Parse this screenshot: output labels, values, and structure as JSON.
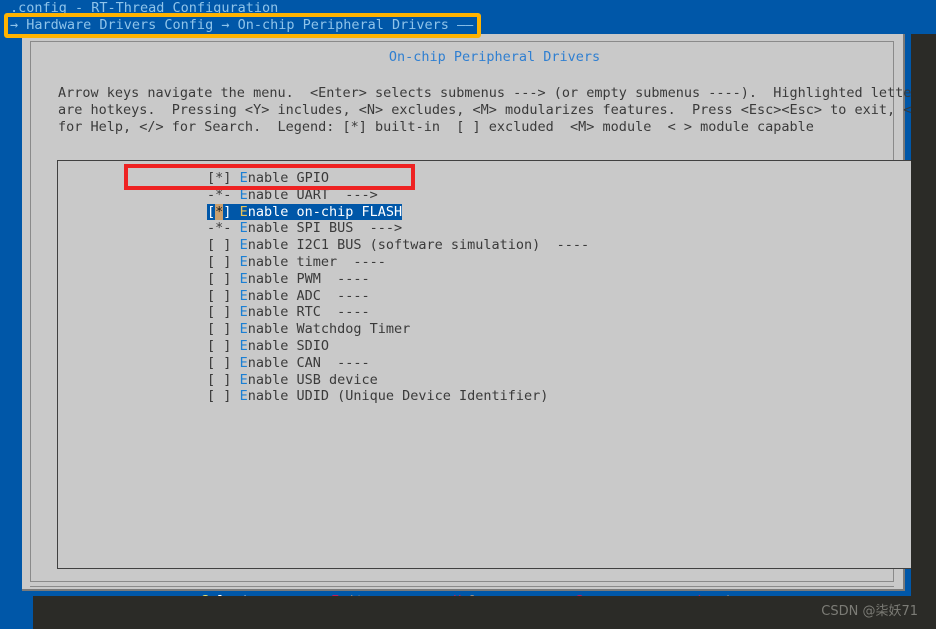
{
  "terminal": {
    "title": ".config - RT-Thread Configuration",
    "breadcrumb": "→ Hardware Drivers Config → On-chip Peripheral Drivers ——"
  },
  "dialog": {
    "frame_title": "On-chip Peripheral Drivers",
    "help_text": "Arrow keys navigate the menu.  <Enter> selects submenus ---> (or empty submenus ----).  Highlighted letters\nare hotkeys.  Pressing <Y> includes, <N> excludes, <M> modularizes features.  Press <Esc><Esc> to exit, <?>\nfor Help, </> for Search.  Legend: [*] built-in  [ ] excluded  <M> module  < > module capable"
  },
  "menu": {
    "items": [
      {
        "mark": "[*]",
        "hotkey": "E",
        "label": "nable GPIO",
        "suffix": "",
        "selected": false
      },
      {
        "mark": "-*-",
        "hotkey": "E",
        "label": "nable UART",
        "suffix": "  --->",
        "selected": false
      },
      {
        "mark": "[*]",
        "hotkey": "E",
        "label": "nable on-chip FLASH",
        "suffix": "",
        "selected": true
      },
      {
        "mark": "-*-",
        "hotkey": "E",
        "label": "nable SPI BUS",
        "suffix": "  --->",
        "selected": false
      },
      {
        "mark": "[ ]",
        "hotkey": "E",
        "label": "nable I2C1 BUS (software simulation)",
        "suffix": "  ----",
        "selected": false
      },
      {
        "mark": "[ ]",
        "hotkey": "E",
        "label": "nable timer",
        "suffix": "  ----",
        "selected": false
      },
      {
        "mark": "[ ]",
        "hotkey": "E",
        "label": "nable PWM",
        "suffix": "  ----",
        "selected": false
      },
      {
        "mark": "[ ]",
        "hotkey": "E",
        "label": "nable ADC",
        "suffix": "  ----",
        "selected": false
      },
      {
        "mark": "[ ]",
        "hotkey": "E",
        "label": "nable RTC",
        "suffix": "  ----",
        "selected": false
      },
      {
        "mark": "[ ]",
        "hotkey": "E",
        "label": "nable Watchdog Timer",
        "suffix": "",
        "selected": false
      },
      {
        "mark": "[ ]",
        "hotkey": "E",
        "label": "nable SDIO",
        "suffix": "",
        "selected": false
      },
      {
        "mark": "[ ]",
        "hotkey": "E",
        "label": "nable CAN",
        "suffix": "  ----",
        "selected": false
      },
      {
        "mark": "[ ]",
        "hotkey": "E",
        "label": "nable USB device",
        "suffix": "",
        "selected": false
      },
      {
        "mark": "[ ]",
        "hotkey": "E",
        "label": "nable UDID (Unique Device Identifier)",
        "suffix": "",
        "selected": false
      }
    ]
  },
  "buttons": [
    {
      "open": "<",
      "hot": "S",
      "rest": "elect",
      "close": ">",
      "active": true
    },
    {
      "open": "< ",
      "hot": "E",
      "rest": "xit",
      "close": " >",
      "active": false
    },
    {
      "open": "< ",
      "hot": "H",
      "rest": "elp",
      "close": " >",
      "active": false
    },
    {
      "open": "< ",
      "hot": "S",
      "rest": "ave",
      "close": " >",
      "active": false
    },
    {
      "open": "< ",
      "hot": "L",
      "rest": "oad",
      "close": " >",
      "active": false
    }
  ],
  "annotations": {
    "yellow_box_target": "breadcrumb-path",
    "red_box_target": "menu-item-enable-on-chip-flash"
  },
  "watermark": "CSDN @柒妖71",
  "colors": {
    "terminal_background": "#0057a8",
    "dialog_background": "#c9c9c9",
    "selection_blue": "#0057a8",
    "hotkey_blue": "#1a7fd4",
    "hotkey_red": "#c2185b",
    "annotation_yellow": "#ffb300",
    "annotation_red": "#ee2222",
    "cursor_tan": "#c8a070"
  }
}
